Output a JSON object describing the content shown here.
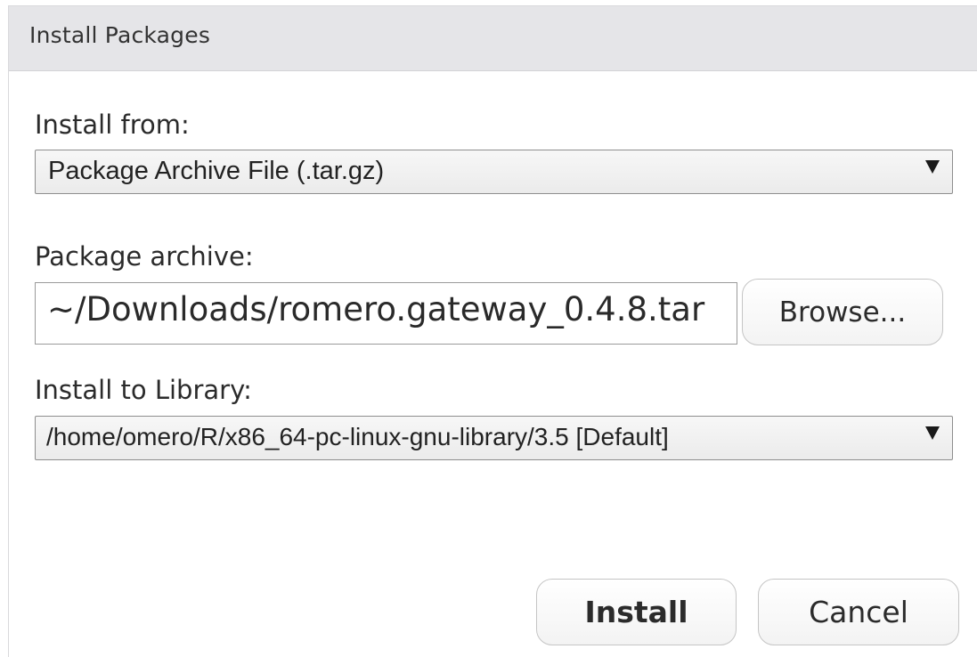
{
  "dialog": {
    "title": "Install Packages"
  },
  "install_from": {
    "label": "Install from:",
    "selected": "Package Archive File (.tar.gz)"
  },
  "package_archive": {
    "label": "Package archive:",
    "value": "~/Downloads/romero.gateway_0.4.8.tar",
    "browse_label": "Browse..."
  },
  "install_to_library": {
    "label": "Install to Library:",
    "selected": "/home/omero/R/x86_64-pc-linux-gnu-library/3.5 [Default]"
  },
  "footer": {
    "install_label": "Install",
    "cancel_label": "Cancel"
  },
  "icons": {
    "dropdown": "chevron-down-icon"
  }
}
